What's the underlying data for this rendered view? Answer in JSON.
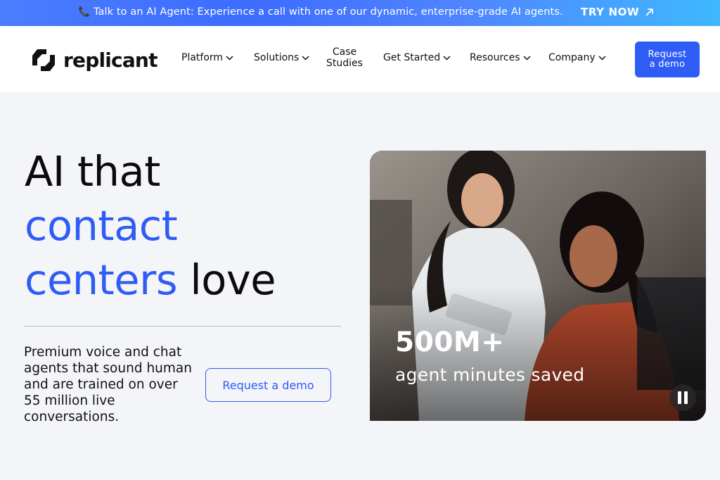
{
  "announcement": {
    "icon": "phone-icon",
    "message": "Talk to an AI Agent: Experience a call with one of our dynamic, enterprise-grade AI agents.",
    "cta": "TRY NOW"
  },
  "header": {
    "logo_text": "replicant",
    "nav": [
      {
        "label": "Platform"
      },
      {
        "label": "Solutions"
      },
      {
        "label": "Case Studies",
        "lines": [
          "Case",
          "Studies"
        ]
      },
      {
        "label": "Get Started"
      },
      {
        "label": "Resources"
      },
      {
        "label": "Company"
      }
    ],
    "cta_lines": [
      "Request",
      "a demo"
    ]
  },
  "hero": {
    "title_line1": "AI that",
    "title_line2_blue": "contact",
    "title_line3_blue": "centers",
    "title_line3_rest": "love",
    "description": "Premium voice and chat agents that sound human and are trained on over 55 million live conversations.",
    "button": "Request a demo"
  },
  "media": {
    "stat_value": "500M+",
    "stat_label": "agent minutes saved",
    "pause_icon": "pause-icon"
  },
  "colors": {
    "accent": "#2f5cf5",
    "background": "#f4f5f9"
  }
}
